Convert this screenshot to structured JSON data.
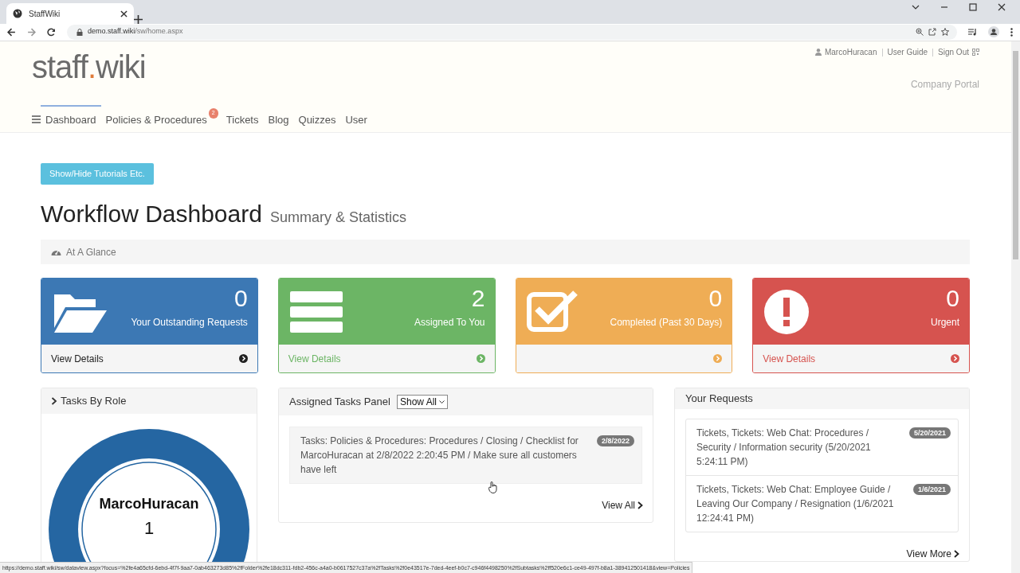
{
  "browser": {
    "tab_title": "StaffWiki",
    "url_host": "demo.staff.wiki",
    "url_path": "/sw/home.aspx"
  },
  "header": {
    "logo": [
      "staff",
      ".",
      "wiki"
    ],
    "user": "MarcoHuracan",
    "links": [
      "User Guide",
      "Sign Out"
    ],
    "portal": "Company Portal"
  },
  "nav": [
    {
      "label": "Dashboard",
      "selected": true
    },
    {
      "label": "Policies & Procedures",
      "selected": false,
      "badge": "2"
    },
    {
      "label": "Tickets",
      "selected": false
    },
    {
      "label": "Blog",
      "selected": false
    },
    {
      "label": "Quizzes",
      "selected": false
    },
    {
      "label": "User",
      "selected": false
    }
  ],
  "tutorial_button": "Show/Hide Tutorials Etc.",
  "title": "Workflow Dashboard",
  "subtitle": "Summary & Statistics",
  "glance_label": "At A Glance",
  "stat_cards": [
    {
      "kind": "folder",
      "color": "#3c78b4",
      "count": "0",
      "label": "Your Outstanding Requests",
      "link": "View Details"
    },
    {
      "kind": "list",
      "color": "#6cb565",
      "count": "2",
      "label": "Assigned To You",
      "link": "View Details"
    },
    {
      "kind": "check",
      "color": "#efad55",
      "count": "0",
      "label": "Completed (Past 30 Days)"
    },
    {
      "kind": "alert",
      "color": "#d6534f",
      "count": "0",
      "label": "Urgent",
      "link": "View Details"
    }
  ],
  "tasks_by_role": {
    "title": "Tasks By Role",
    "role": "MarcoHuracan",
    "count": "1"
  },
  "assigned": {
    "title": "Assigned Tasks Panel",
    "filter": "Show All",
    "items": [
      {
        "text": "Tasks: Policies & Procedures: Procedures / Closing / Checklist for MarcoHuracan at 2/8/2022 2:20:45 PM / Make sure all customers have left",
        "date": "2/8/2022"
      }
    ],
    "link": "View All"
  },
  "requests": {
    "title": "Your Requests",
    "items": [
      {
        "text": "Tickets, Tickets: Web Chat: Procedures / Security / Information security (5/20/2021 5:24:11 PM)",
        "date": "5/20/2021"
      },
      {
        "text": "Tickets, Tickets: Web Chat: Employee Guide / Leaving Our Company / Resignation (1/6/2021 12:24:41 PM)",
        "date": "1/6/2021"
      }
    ],
    "link": "View More"
  },
  "status_url": "https://demo.staff.wiki/sw/dataview.aspx?focus=%2fe4a65cfd-6ebd-4f7f-9aa7-0ab463273d85%2fFolder%2fe18dc311-fdb2-456c-a4a0-b0617527c37a%2fTasks%2f0e43517e-7ded-4eef-b0c7-c946f4498250%2fSubtasks%2ff520e6c1-ce49-497f-b8a1-389412501418&view=Policies"
}
